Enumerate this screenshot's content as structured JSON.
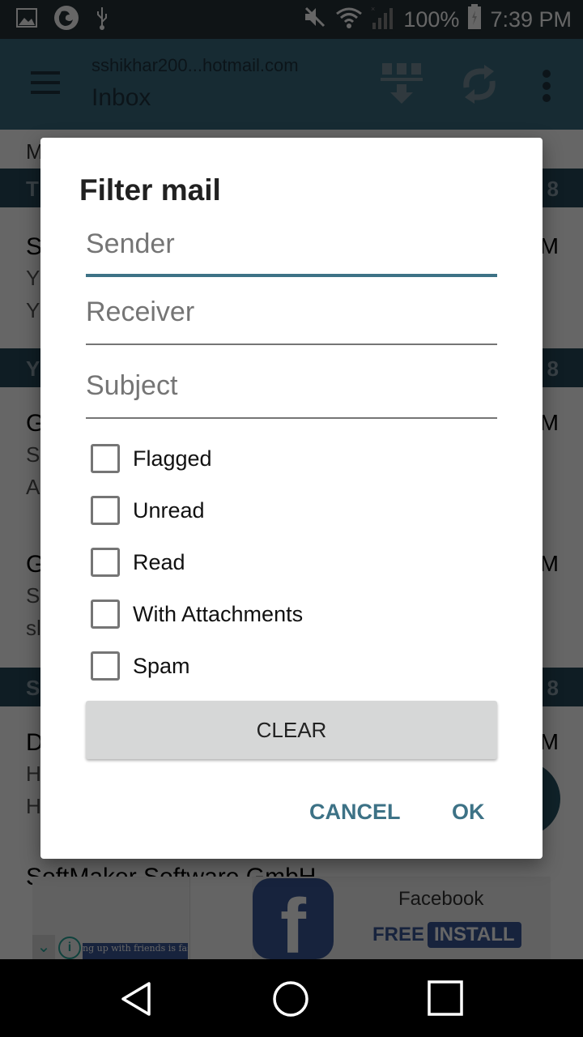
{
  "status_bar": {
    "left_icons": [
      "gallery-icon",
      "firefox-icon",
      "usb-icon"
    ],
    "right_icons": [
      "mute-icon",
      "wifi-icon",
      "signal-icon",
      "battery-charging-icon"
    ],
    "battery": "100%",
    "time": "7:39 PM"
  },
  "app_bar": {
    "account": "sshikhar200...hotmail.com",
    "folder": "Inbox",
    "actions": [
      "download-icon",
      "sync-icon",
      "more-vert-icon"
    ]
  },
  "list": {
    "top_label": "M",
    "sections": [
      {
        "left": "T",
        "right": "8"
      },
      {
        "left": "Y",
        "right": "8"
      },
      {
        "left": "S",
        "right": "8"
      }
    ],
    "rows": [
      {
        "from": "S",
        "time": "M",
        "line2": "Y",
        "line3": "Y"
      },
      {
        "from": "G",
        "time": "M",
        "line2": "S",
        "line3": "A"
      },
      {
        "from": "G",
        "time": "M",
        "line2": "S",
        "line3": "sl"
      },
      {
        "from": "D",
        "time": "M",
        "line2": "H",
        "line3": "H"
      }
    ],
    "partial_row": "SoftMaker Software GmbH"
  },
  "ad": {
    "app_name": "Facebook",
    "free_label": "FREE",
    "install_label": "INSTALL",
    "tagline": "ng up with friends is faster.",
    "logo_letter": "f",
    "info_icon": "i"
  },
  "dialog": {
    "title": "Filter mail",
    "fields": [
      {
        "name": "sender",
        "placeholder": "Sender",
        "value": ""
      },
      {
        "name": "receiver",
        "placeholder": "Receiver",
        "value": ""
      },
      {
        "name": "subject",
        "placeholder": "Subject",
        "value": ""
      }
    ],
    "checkboxes": [
      {
        "label": "Flagged",
        "checked": false
      },
      {
        "label": "Unread",
        "checked": false
      },
      {
        "label": "Read",
        "checked": false
      },
      {
        "label": "With Attachments",
        "checked": false
      },
      {
        "label": "Spam",
        "checked": false
      }
    ],
    "clear_label": "CLEAR",
    "cancel_label": "CANCEL",
    "ok_label": "OK"
  },
  "colors": {
    "accent": "#3d7286",
    "app_bar": "#3b6d80",
    "section_header": "#264a5a",
    "status_bar": "#263238"
  }
}
